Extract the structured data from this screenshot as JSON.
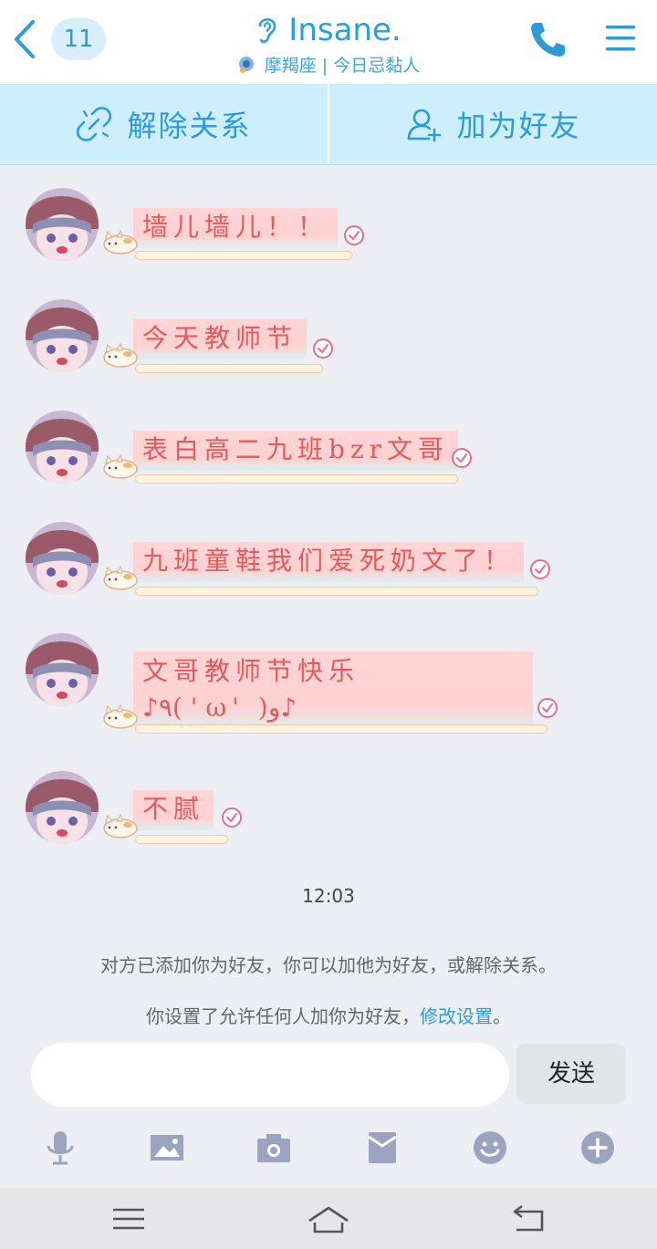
{
  "header": {
    "unread_count": "11",
    "title": "Insane.",
    "subtitle": "摩羯座 | 今日忌黏人",
    "accent": "#29a0dc"
  },
  "actions": {
    "unlink_label": "解除关系",
    "add_friend_label": "加为好友"
  },
  "messages": [
    {
      "text": "墙儿墙儿！！"
    },
    {
      "text": "今天教师节"
    },
    {
      "text": "表白高二九班bzr文哥"
    },
    {
      "text": "九班童鞋我们爱死奶文了！"
    },
    {
      "line1": "文哥教师节快乐",
      "line2": "♪٩( ' ω' )و♪"
    },
    {
      "text": "不腻"
    }
  ],
  "time_label": "12:03",
  "notice": {
    "line1": "对方已添加你为好友，你可以加他为好友，或解除关系。",
    "line2_prefix": "你设置了允许任何人加你为好友，",
    "line2_link": "修改设置",
    "line2_suffix": "。"
  },
  "input": {
    "value": "",
    "send_label": "发送"
  },
  "toolbar_icons": [
    "microphone-icon",
    "image-icon",
    "camera-icon",
    "red-packet-icon",
    "emoji-icon",
    "plus-icon"
  ],
  "bubble_colors": {
    "fill": "#ffd4d4",
    "text": "#e25a5a"
  }
}
